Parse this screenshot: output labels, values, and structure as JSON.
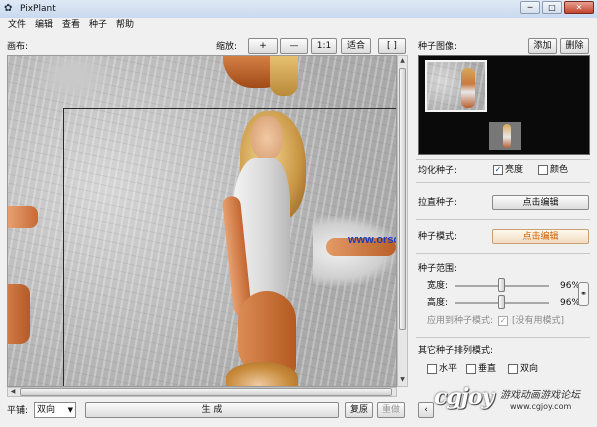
{
  "app": {
    "title": "PixPlant"
  },
  "menu": [
    "文件",
    "编辑",
    "查看",
    "种子",
    "帮助"
  ],
  "window_controls": {
    "minimize": "─",
    "maximize": "□",
    "close": "✕"
  },
  "toolbar": {
    "canvas_label": "画布:",
    "zoom_label": "缩放:",
    "zoom_in": "+",
    "zoom_out": "—",
    "zoom_1to1": "1:1",
    "zoom_fit": "适合",
    "zoom_frame": "[ ]"
  },
  "seed_image": {
    "label": "种子图像:",
    "add": "添加",
    "delete": "删除"
  },
  "equalize": {
    "label": "均化种子:",
    "brightness": "亮度",
    "brightness_checked": true,
    "color": "颜色",
    "color_checked": false
  },
  "straighten": {
    "label": "拉直种子:",
    "button": "点击编辑"
  },
  "seed_mode": {
    "label": "种子模式:",
    "button": "点击编辑"
  },
  "seed_range": {
    "label": "种子范围:",
    "width_label": "宽度:",
    "width_value": "96%",
    "width_percent": 96,
    "height_label": "高度:",
    "height_value": "96%",
    "height_percent": 96,
    "apply_label": "应用到种子模式:",
    "apply_note": "[没有用模式]"
  },
  "other_patterns": {
    "label": "其它种子排列模式:",
    "horizontal": "水平",
    "vertical": "垂直",
    "both": "双向"
  },
  "bottom": {
    "tile_label": "平铺:",
    "tile_value": "双向",
    "generate": "生 成",
    "restore": "复原",
    "redo": "重做"
  },
  "watermarks": {
    "site": "www.orsoon.com",
    "brand": "cgjoy",
    "brand_cn": "游戏动画游戏论坛",
    "brand_url": "www.cgjoy.com"
  },
  "colors": {
    "accent": "#1a3fbf",
    "orange_text": "#d06000"
  }
}
